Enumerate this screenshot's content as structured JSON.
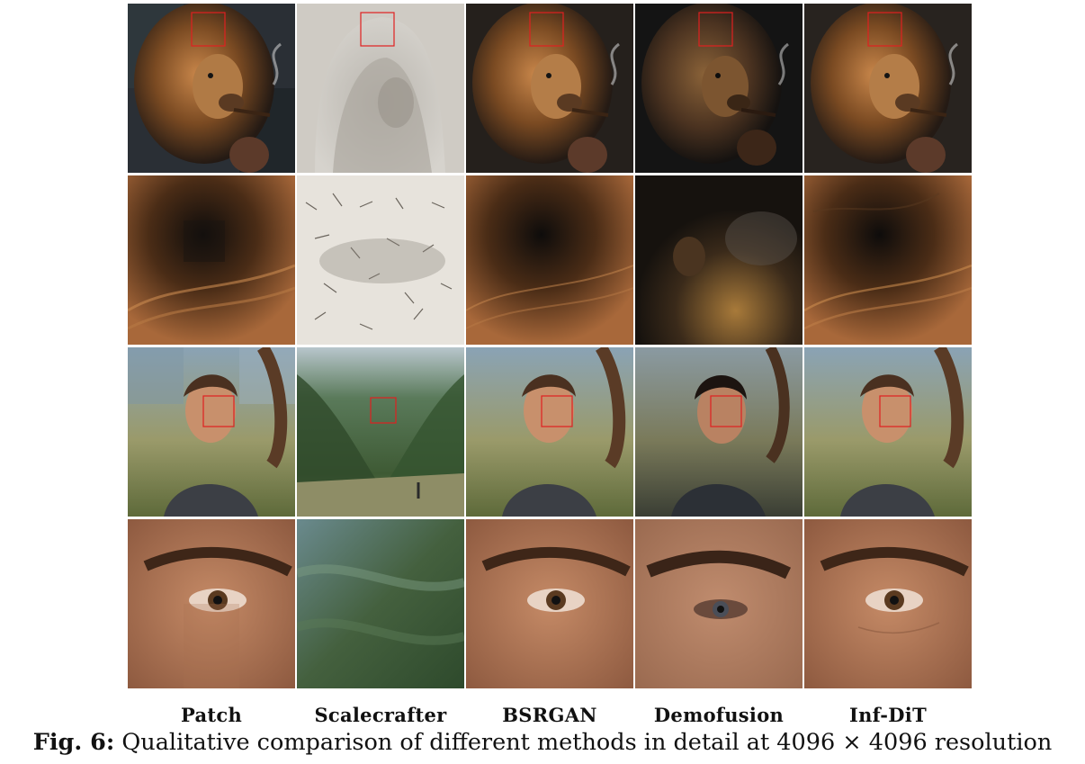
{
  "figure": {
    "column_labels": [
      "Patch",
      "Scalecrafter",
      "BSRGAN",
      "Demofusion",
      "Inf-DiT"
    ],
    "caption_label": "Fig. 6:",
    "caption_text": " Qualitative comparison of different methods in detail at 4096 × 4096 resolution"
  }
}
